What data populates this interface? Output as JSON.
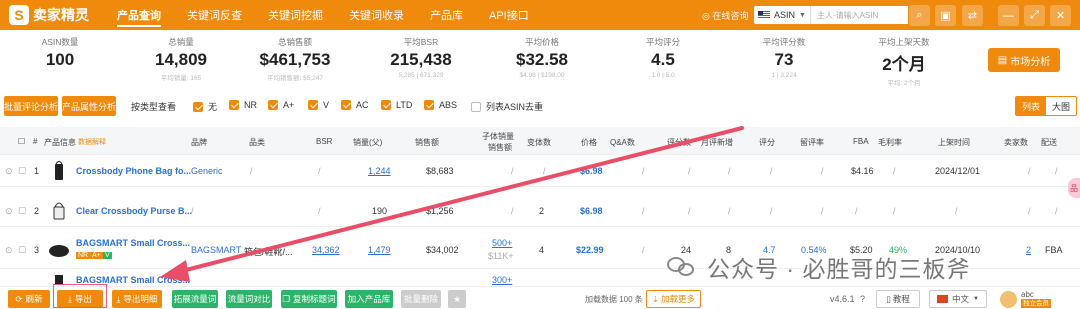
{
  "brand": {
    "name": "卖家精灵",
    "logo_char": "S"
  },
  "nav": [
    "产品查询",
    "关键词反查",
    "关键词挖掘",
    "关键词收录",
    "产品库",
    "API接口"
  ],
  "header": {
    "site_link": "在线咨询",
    "market": "ASIN",
    "search_placeholder": "主人-请输入ASIN",
    "colors": {
      "accent": "#f08a0c",
      "link": "#2a6fd6",
      "positive": "#2db46a"
    }
  },
  "stats": [
    {
      "label": "ASIN数量",
      "value": "100",
      "sub": ""
    },
    {
      "label": "总销量",
      "value": "14,809",
      "sub": "平均销量: 165"
    },
    {
      "label": "总销售额",
      "value": "$461,753",
      "sub": "平均销售额: $5,247"
    },
    {
      "label": "平均BSR",
      "value": "215,438",
      "sub": "5,285 | 671,329"
    },
    {
      "label": "平均价格",
      "value": "$32.58",
      "sub": "$4.98 | $198.00"
    },
    {
      "label": "平均评分",
      "value": "4.5",
      "sub": "1.0 | 5.0"
    },
    {
      "label": "平均评分数",
      "value": "73",
      "sub": "1 | 3,224"
    },
    {
      "label": "平均上架天数",
      "value": "2个月",
      "sub": "平均: 2个月"
    }
  ],
  "market_button": "市场分析",
  "filters": {
    "btn_reviews": "批量评论分析",
    "btn_attributes": "产品属性分析",
    "type_label": "按类型查看",
    "checks": [
      {
        "label": "无",
        "checked": true
      },
      {
        "label": "NR",
        "checked": true
      },
      {
        "label": "A+",
        "checked": true
      },
      {
        "label": "V",
        "checked": true
      },
      {
        "label": "AC",
        "checked": true
      },
      {
        "label": "LTD",
        "checked": true
      },
      {
        "label": "ABS",
        "checked": true
      },
      {
        "label": "列表ASIN去重",
        "checked": false
      }
    ],
    "view_list": "列表",
    "view_grid": "大图"
  },
  "table": {
    "headers": {
      "hash": "#",
      "product": "产品信息",
      "product_note": "数据解释",
      "brand": "品牌",
      "category": "品类",
      "bsr": "BSR",
      "units": "销量(父)",
      "revenue": "销售额",
      "child_units": "子体销量",
      "child_revenue": "销售额",
      "variants": "变体数",
      "price": "价格",
      "qa": "Q&A数",
      "ratings": "评分数",
      "monthly_new": "月评新增",
      "rating": "评分",
      "review_rate": "留评率",
      "fba": "FBA",
      "margin": "毛利率",
      "date": "上架时间",
      "sellers": "卖家数",
      "delivery": "配送"
    },
    "rows": [
      {
        "idx": "1",
        "title": "Crossbody Phone Bag fo...",
        "brand": "Generic",
        "category": "/",
        "bsr": "/",
        "units": "1,244",
        "revenue": "$8,683",
        "child_units": "/",
        "child_revenue": "",
        "variants": "/",
        "price": "$6.98",
        "qa": "/",
        "ratings": "/",
        "monthly_new": "/",
        "rating": "/",
        "review_rate": "/",
        "fba": "$4.16",
        "margin": "/",
        "date": "2024/12/01",
        "sellers": "/",
        "delivery": "/"
      },
      {
        "idx": "2",
        "title": "Clear Crossbody Purse B...",
        "brand": "/",
        "category": "",
        "bsr": "/",
        "units": "190",
        "revenue": "$1,256",
        "child_units": "/",
        "child_revenue": "",
        "variants": "2",
        "price": "$6.98",
        "qa": "/",
        "ratings": "/",
        "monthly_new": "/",
        "rating": "/",
        "review_rate": "/",
        "fba": "/",
        "margin": "/",
        "date": "/",
        "sellers": "/",
        "delivery": "/"
      },
      {
        "idx": "3",
        "title": "BAGSMART Small Cross...",
        "brand": "BAGSMART",
        "category": "箱包/鞋靴/...",
        "bsr": "34,362",
        "units": "1,479",
        "revenue": "$34,002",
        "child_units": "500+",
        "child_revenue": "$11K+",
        "variants": "4",
        "price": "$22.99",
        "qa": "/",
        "ratings": "24",
        "monthly_new": "8",
        "rating": "4.7",
        "review_rate": "0.54%",
        "fba": "$5.20",
        "margin": "49%",
        "date": "2024/10/10",
        "sellers": "2",
        "delivery": "FBA"
      },
      {
        "idx": "4",
        "title": "BAGSMART Small Cross...",
        "child_units": "300+"
      }
    ],
    "badges": [
      "NR",
      "A+",
      "V"
    ]
  },
  "bottom": {
    "refresh": "刷新",
    "export": "导出",
    "export_detail": "导出明细",
    "expand_traffic": "拓展流量词",
    "compare_traffic": "流量词对比",
    "copy_title": "复制标题词",
    "add_library": "加入产品库",
    "batch_delete": "批量删除",
    "loaded": "加载数据 100 条",
    "load_more": "加载更多",
    "version": "v4.6.1",
    "help_icon": "question-icon",
    "tutorial": "教程",
    "language": "中文",
    "user": "abc",
    "user_tag": "独立会员"
  },
  "watermark": "公众号 · 必胜哥的三板斧",
  "side_pill": "品"
}
